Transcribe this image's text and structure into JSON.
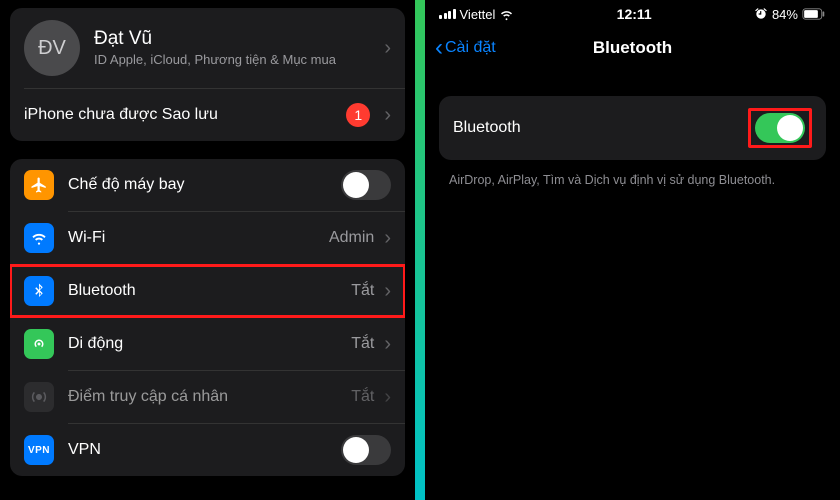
{
  "left": {
    "profile": {
      "initials": "ĐV",
      "name": "Đạt Vũ",
      "subtitle": "ID Apple, iCloud, Phương tiện & Mục mua"
    },
    "backup": {
      "label": "iPhone chưa được Sao lưu",
      "badge": "1"
    },
    "settings": {
      "airplane": {
        "label": "Chế độ máy bay"
      },
      "wifi": {
        "label": "Wi-Fi",
        "value": "Admin"
      },
      "bluetooth": {
        "label": "Bluetooth",
        "value": "Tắt"
      },
      "cellular": {
        "label": "Di động",
        "value": "Tắt"
      },
      "hotspot": {
        "label": "Điểm truy cập cá nhân",
        "value": "Tắt"
      },
      "vpn": {
        "label": "VPN",
        "icon_text": "VPN"
      }
    }
  },
  "right": {
    "status": {
      "carrier": "Viettel",
      "time": "12:11",
      "battery": "84%"
    },
    "nav": {
      "back": "Cài đặt",
      "title": "Bluetooth"
    },
    "bluetooth": {
      "label": "Bluetooth"
    },
    "footer": "AirDrop, AirPlay, Tìm và Dịch vụ định vị sử dụng Bluetooth."
  }
}
